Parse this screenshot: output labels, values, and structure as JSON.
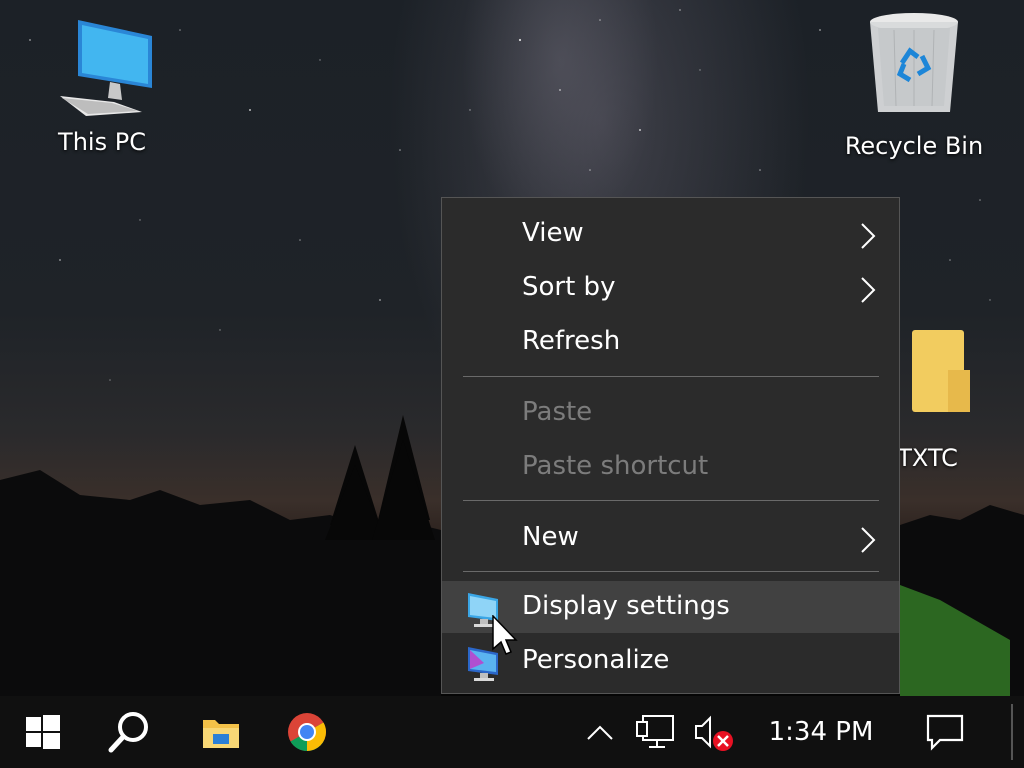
{
  "desktop": {
    "icons": {
      "this_pc": "This PC",
      "recycle_bin": "Recycle Bin",
      "folder_partial": "hTXTC"
    }
  },
  "context_menu": {
    "view": "View",
    "sort_by": "Sort by",
    "refresh": "Refresh",
    "paste": "Paste",
    "paste_shortcut": "Paste shortcut",
    "new": "New",
    "display_settings": "Display settings",
    "personalize": "Personalize"
  },
  "taskbar": {
    "clock": "1:34 PM",
    "icons": [
      "windows-start-icon",
      "search-icon",
      "file-explorer-icon",
      "chrome-icon",
      "show-hidden-icons-icon",
      "network-icon",
      "volume-muted-icon",
      "action-center-icon"
    ]
  },
  "colors": {
    "menu_bg": "#2b2b2b",
    "menu_hover": "#414141",
    "taskbar_bg": "#101010",
    "disabled_text": "#7c7c7c"
  }
}
